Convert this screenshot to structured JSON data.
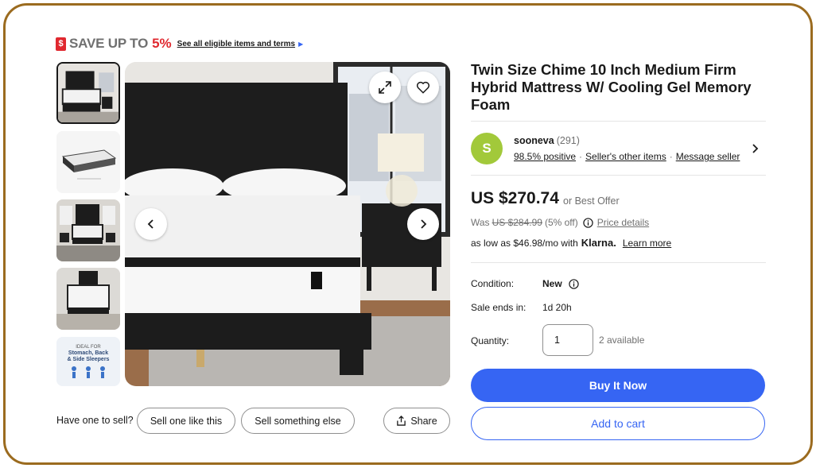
{
  "promo": {
    "icon": "sale-tag-icon",
    "tag_glyph": "$",
    "save_text": "SAVE UP TO",
    "save_percent": "5%",
    "see_all_link": "See all eligible items and terms",
    "accent_color": "#e0282f"
  },
  "gallery": {
    "thumbnails": [
      {
        "icon": "mattress-bedroom-thumbnail"
      },
      {
        "icon": "mattress-layers-thumbnail"
      },
      {
        "icon": "bedroom-wide-thumbnail"
      },
      {
        "icon": "bed-frame-thumbnail"
      },
      {
        "icon": "sleeper-types-thumbnail",
        "text_line1": "Stomach, Back",
        "text_line2": "& Side Sleepers"
      }
    ],
    "active_index": 0
  },
  "sell": {
    "question": "Have one to sell?",
    "sell_like_this": "Sell one like this",
    "sell_other": "Sell something else",
    "share": "Share"
  },
  "product": {
    "title": "Twin Size Chime 10 Inch Medium Firm Hybrid Mattress W/ Cooling Gel Memory Foam"
  },
  "seller": {
    "avatar_letter": "S",
    "avatar_color": "#a2c93a",
    "name": "sooneva",
    "feedback_count": "(291)",
    "positive": "98.5% positive",
    "other_items": "Seller's other items",
    "message": "Message seller"
  },
  "pricing": {
    "price": "US $270.74",
    "best_offer": "or Best Offer",
    "was_label": "Was",
    "was_price": "US $284.99",
    "discount": "(5% off)",
    "price_details": "Price details",
    "klarna_prefix": "as low as $46.98/mo with",
    "klarna_brand": "Klarna.",
    "learn_more": "Learn more"
  },
  "details": {
    "condition_label": "Condition:",
    "condition_value": "New",
    "sale_label": "Sale ends in:",
    "sale_value": "1d 20h",
    "quantity_label": "Quantity:",
    "quantity_value": "1",
    "available": "2 available"
  },
  "actions": {
    "buy_now": "Buy It Now",
    "add_to_cart": "Add to cart",
    "primary_color": "#3665f3"
  }
}
